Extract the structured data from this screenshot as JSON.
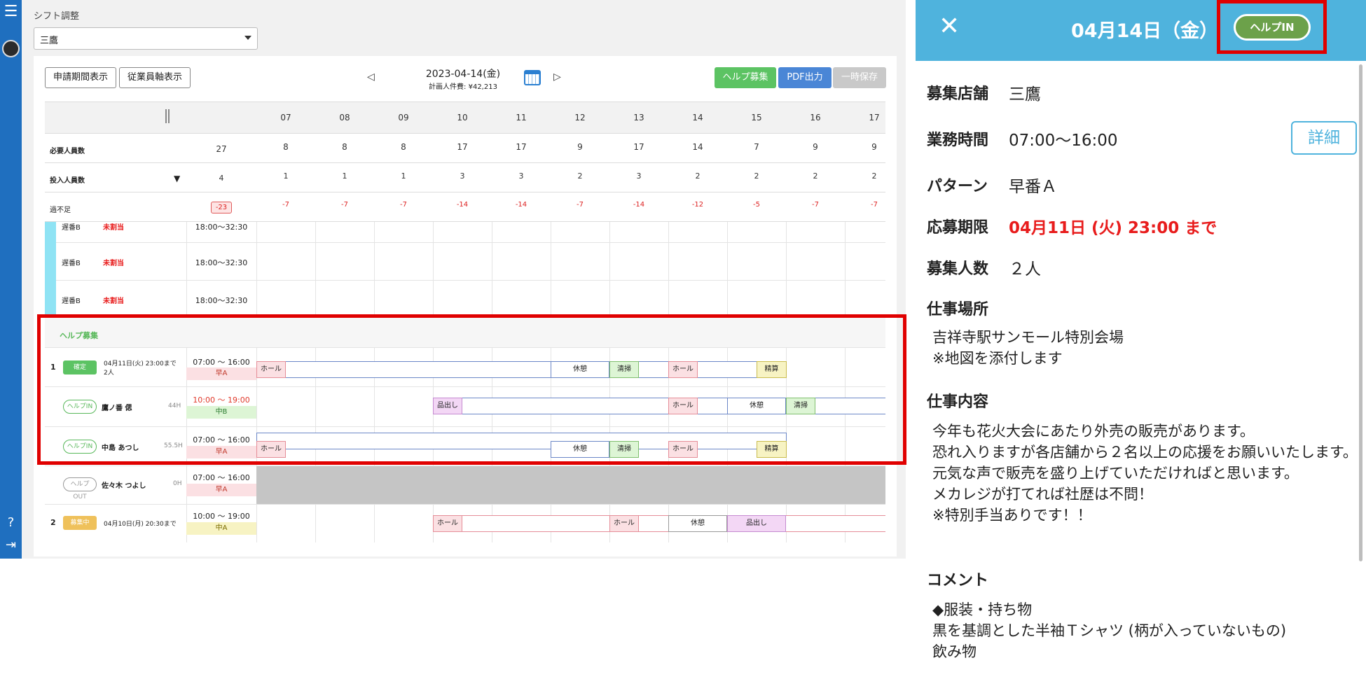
{
  "page": {
    "title": "シフト調整",
    "store": "三鷹"
  },
  "toolbar": {
    "period_button": "申請期間表示",
    "employee_button": "従業員軸表示",
    "date": "2023-04-14(金)",
    "cost": "計画人件費: ¥42,213",
    "help_button": "ヘルプ募集",
    "pdf_button": "PDF出力",
    "save_button": "一時保存"
  },
  "hours": [
    "07",
    "08",
    "09",
    "10",
    "11",
    "12",
    "13",
    "14",
    "15",
    "16",
    "17"
  ],
  "summary": {
    "required_label": "必要人員数",
    "required_total": "27",
    "required": [
      "8",
      "8",
      "8",
      "17",
      "17",
      "9",
      "17",
      "14",
      "7",
      "9",
      "9"
    ],
    "assigned_label": "投入人員数",
    "assigned_total": "4",
    "assigned": [
      "1",
      "1",
      "1",
      "3",
      "3",
      "2",
      "3",
      "2",
      "2",
      "2",
      "2"
    ],
    "shortage_label": "過不足",
    "shortage_total": "-23",
    "shortage": [
      "-7",
      "-7",
      "-7",
      "-14",
      "-14",
      "-7",
      "-14",
      "-12",
      "-5",
      "-7",
      "-7"
    ]
  },
  "shift_rows": [
    {
      "pattern": "遅番B",
      "status": "未割当",
      "time": "18:00～32:30"
    },
    {
      "pattern": "遅番B",
      "status": "未割当",
      "time": "18:00～32:30"
    },
    {
      "pattern": "遅番B",
      "status": "未割当",
      "time": "18:00～32:30"
    }
  ],
  "help": {
    "section_title": "ヘルプ募集",
    "item1": {
      "index": "1",
      "badge": "確定",
      "deadline": "04月11日(火) 23:00まで",
      "count": "2人",
      "time": "07:00 ～ 16:00",
      "pattern": "早A",
      "segments": [
        "ホール",
        "休憩",
        "清掃",
        "ホール",
        "精算"
      ]
    },
    "staff1": {
      "badge": "ヘルプIN",
      "name": "鷹ノ番 偲",
      "hours": "44H",
      "time": "10:00 ～ 19:00",
      "pattern": "中B",
      "segments": [
        "品出し",
        "ホール",
        "休憩",
        "清掃"
      ]
    },
    "staff2": {
      "badge": "ヘルプIN",
      "name": "中島 あつし",
      "hours": "55.5H",
      "time": "07:00 ～ 16:00",
      "pattern": "早A",
      "segments": [
        "ホール",
        "休憩",
        "清掃",
        "ホール",
        "精算"
      ]
    },
    "staff3": {
      "badge": "ヘルプOUT",
      "name": "佐々木 つよし",
      "hours": "0H",
      "time": "07:00 ～ 16:00",
      "pattern": "早A"
    },
    "item2": {
      "index": "2",
      "badge": "募集中",
      "deadline": "04月10日(月) 20:30まで",
      "time": "10:00 ～ 19:00",
      "pattern": "中A",
      "segments": [
        "ホール",
        "ホール",
        "休憩",
        "品出し"
      ]
    }
  },
  "panel": {
    "date": "04月14日（金）",
    "status_button": "ヘルプIN",
    "store_label": "募集店舗",
    "store": "三鷹",
    "hours_label": "業務時間",
    "hours": "07:00～16:00",
    "detail_button": "詳細",
    "pattern_label": "パターン",
    "pattern": "早番Ａ",
    "deadline_label": "応募期限",
    "deadline": "04月11日 (火) 23:00 まで",
    "count_label": "募集人数",
    "count": "２人",
    "place_label": "仕事場所",
    "place": "吉祥寺駅サンモール特別会場\n※地図を添付します",
    "content_label": "仕事内容",
    "content": "今年も花火大会にあたり外売の販売があります。\n恐れ入りますが各店舗から２名以上の応援をお願いいたします。\n元気な声で販売を盛り上げていただければと思います。\nメカレジが打てれば社歴は不問！\n※特別手当ありです！！",
    "comment_label": "コメント",
    "comment": "◆服装・持ち物\n黒を基調とした半袖Ｔシャツ (柄が入っていないもの)\n飲み物"
  },
  "colors": {
    "sidebar": "#1f6fbf",
    "panel_header": "#4fb3dd",
    "help_button": "#5cc363",
    "pdf_button": "#4a86d6",
    "alert": "#e81c1c",
    "highlight": "#e00000"
  }
}
